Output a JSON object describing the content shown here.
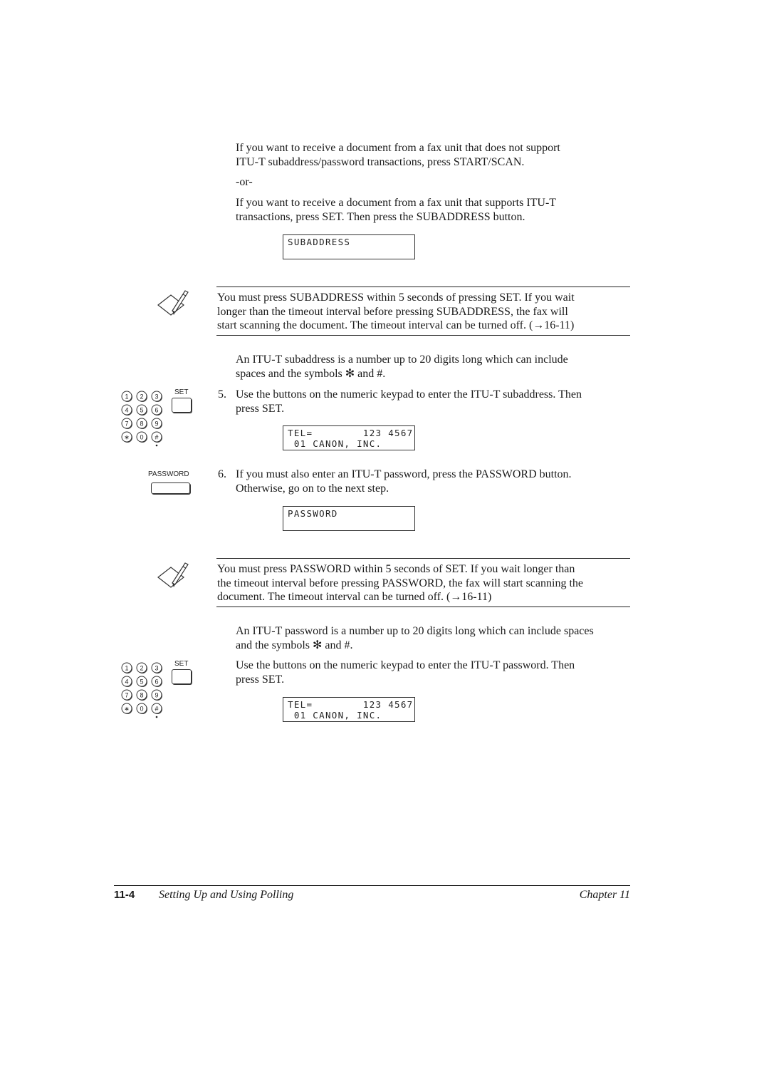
{
  "intro": {
    "p1": "If you want to receive a document from a fax unit that does not support",
    "p1b": "ITU-T subaddress/password transactions, press START/SCAN.",
    "or": "-or-",
    "p2": "If you want to receive a document from a fax unit that supports ITU-T",
    "p2b": "transactions, press SET. Then press the SUBADDRESS button."
  },
  "lcd_subaddress": {
    "line1": "SUBADDRESS",
    "line2": ""
  },
  "note1": {
    "icon": "note-pencil-icon",
    "l1": "You must press SUBADDRESS within 5 seconds of pressing SET. If you wait",
    "l2": "longer than the timeout interval before pressing SUBADDRESS, the fax will",
    "l3": "start scanning the document. The timeout interval can be turned off. (→16-11)"
  },
  "subaddress_info": {
    "l1": "An ITU-T subaddress is a number up to 20 digits long which can include",
    "l2": "spaces and the symbols ✻ and #."
  },
  "step5": {
    "num": "5.",
    "l1": "Use the buttons on the numeric keypad to enter the ITU-T subaddress. Then",
    "l2": "press SET."
  },
  "keypad": {
    "keys": [
      "1",
      "2",
      "3",
      "4",
      "5",
      "6",
      "7",
      "8",
      "9",
      "∗",
      "0",
      "#"
    ],
    "set_label": "SET",
    "password_label": "PASSWORD"
  },
  "lcd_tel_1": {
    "line1": "TEL=        123 4567",
    "line2": " 01 CANON, INC."
  },
  "step6": {
    "num": "6.",
    "l1": "If you must also enter an ITU-T password, press the PASSWORD button.",
    "l2": "Otherwise, go on to the next step."
  },
  "lcd_password": {
    "line1": "PASSWORD",
    "line2": ""
  },
  "note2": {
    "icon": "note-pencil-icon",
    "l1": "You must press PASSWORD within 5 seconds of SET. If you wait longer than",
    "l2": "the timeout interval before pressing PASSWORD, the fax will start scanning the",
    "l3": "document. The timeout interval can be turned off. (→16-11)"
  },
  "password_info": {
    "l1": "An ITU-T password is a number up to 20 digits long which can include spaces",
    "l2": "and the symbols ✻ and #."
  },
  "step7": {
    "l1": "Use the buttons on the numeric keypad to enter the ITU-T password. Then",
    "l2": "press SET."
  },
  "lcd_tel_2": {
    "line1": "TEL=        123 4567",
    "line2": " 01 CANON, INC."
  },
  "footer": {
    "page_number": "11-4",
    "title": "Setting Up and Using Polling",
    "chapter": "Chapter 11"
  }
}
